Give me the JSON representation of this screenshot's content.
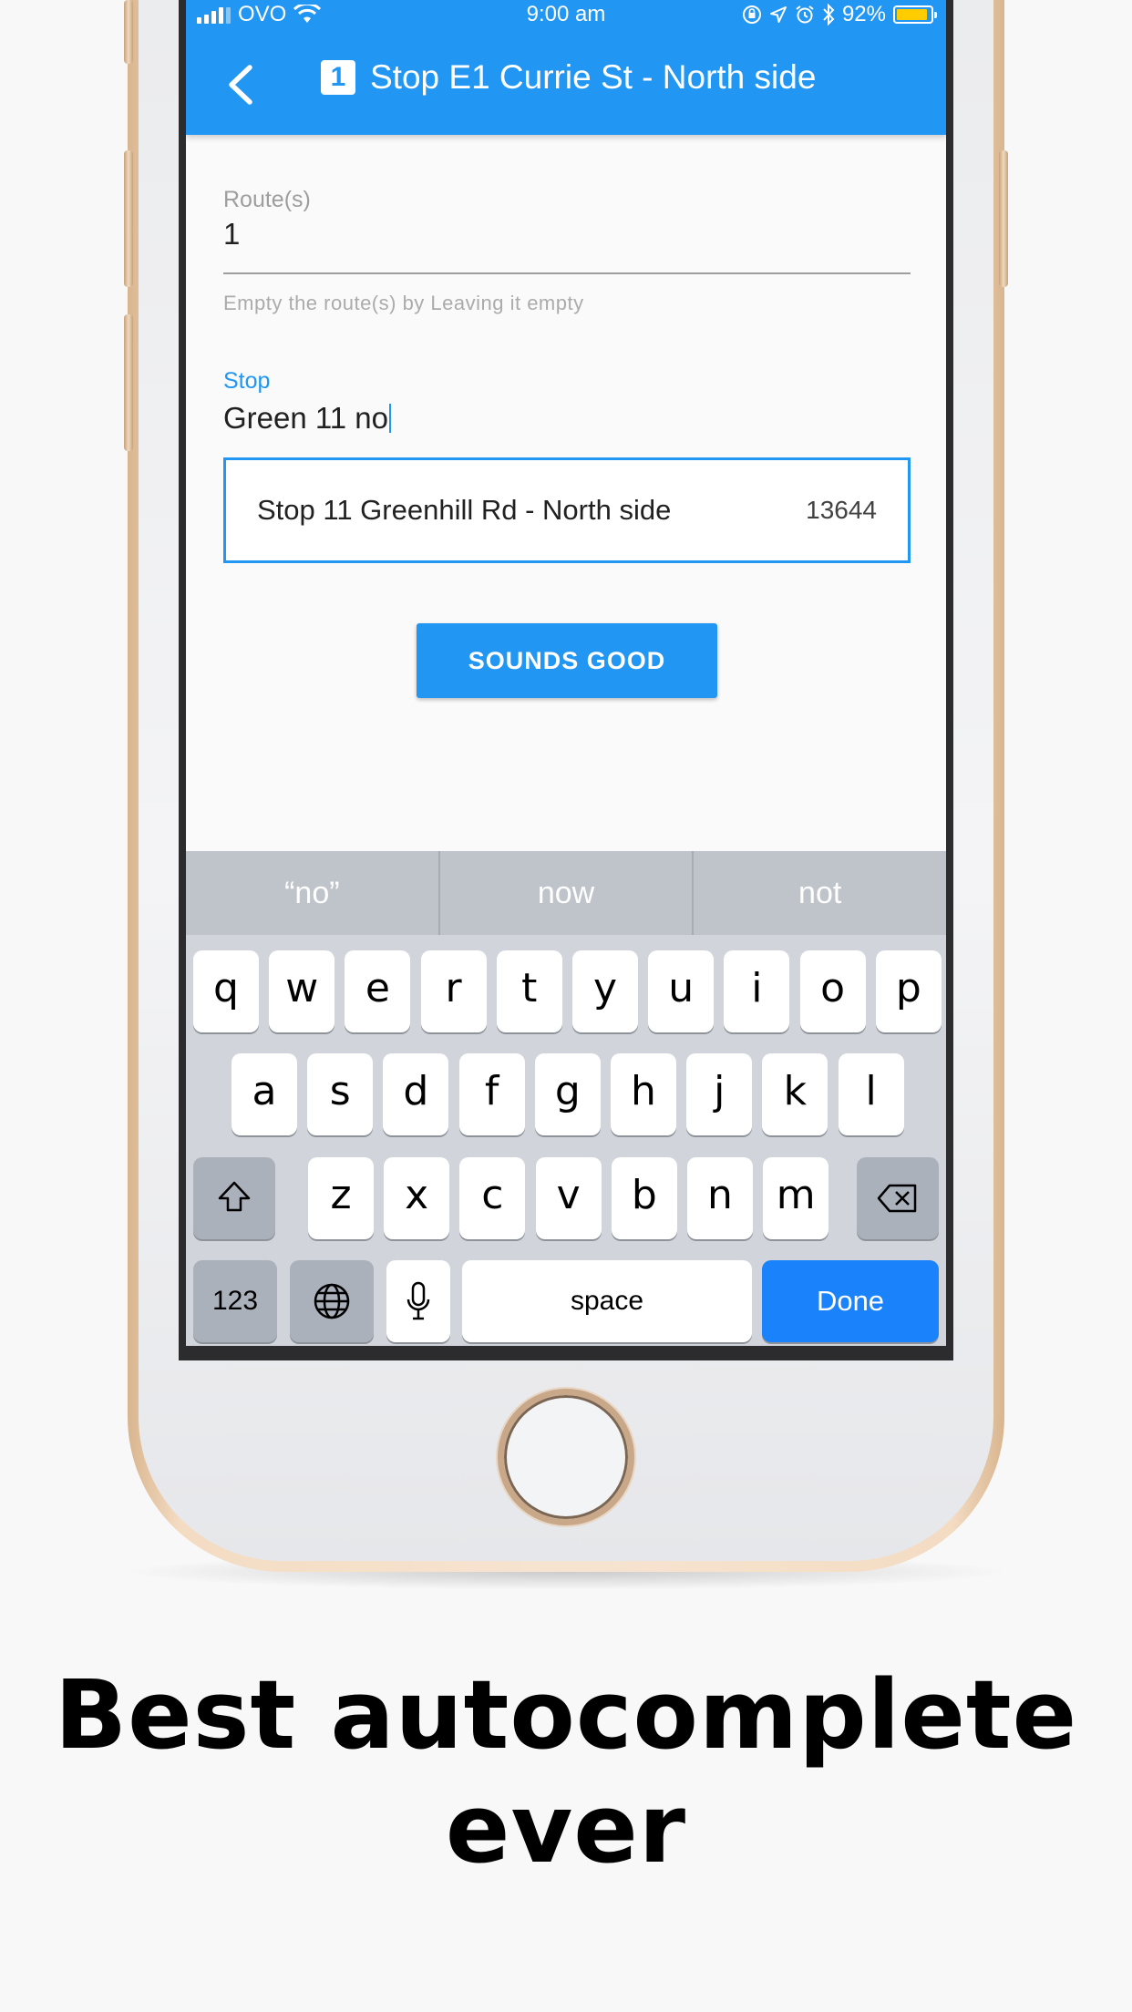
{
  "status_bar": {
    "carrier": "OVO",
    "time": "9:00 am",
    "battery": "92%",
    "battery_level": 0.92
  },
  "app_bar": {
    "route_badge": "1",
    "title": "Stop E1 Currie St - North side"
  },
  "form": {
    "route_label": "Route(s)",
    "route_value": "1",
    "route_helper": "Empty the route(s) by Leaving it empty",
    "stop_label": "Stop",
    "stop_value": "Green 11 no",
    "suggestion": {
      "name": "Stop 11 Greenhill Rd - North side",
      "code": "13644"
    },
    "submit_label": "SOUNDS GOOD"
  },
  "keyboard": {
    "predictions": [
      "“no”",
      "now",
      "not"
    ],
    "row1": [
      "q",
      "w",
      "e",
      "r",
      "t",
      "y",
      "u",
      "i",
      "o",
      "p"
    ],
    "row2": [
      "a",
      "s",
      "d",
      "f",
      "g",
      "h",
      "j",
      "k",
      "l"
    ],
    "row3": [
      "z",
      "x",
      "c",
      "v",
      "b",
      "n",
      "m"
    ],
    "numbers_label": "123",
    "space_label": "space",
    "done_label": "Done"
  },
  "colors": {
    "accent": "#2196f3",
    "done_key": "#1a82fb",
    "phone_gold": "#f4dcc3"
  },
  "icons": [
    "back-arrow-icon",
    "wifi-icon",
    "lock-rotation-icon",
    "location-icon",
    "alarm-icon",
    "bluetooth-icon",
    "shift-icon",
    "backspace-icon",
    "globe-icon",
    "microphone-icon"
  ],
  "headline": {
    "line1": "Best autocomplete",
    "line2": "ever"
  }
}
